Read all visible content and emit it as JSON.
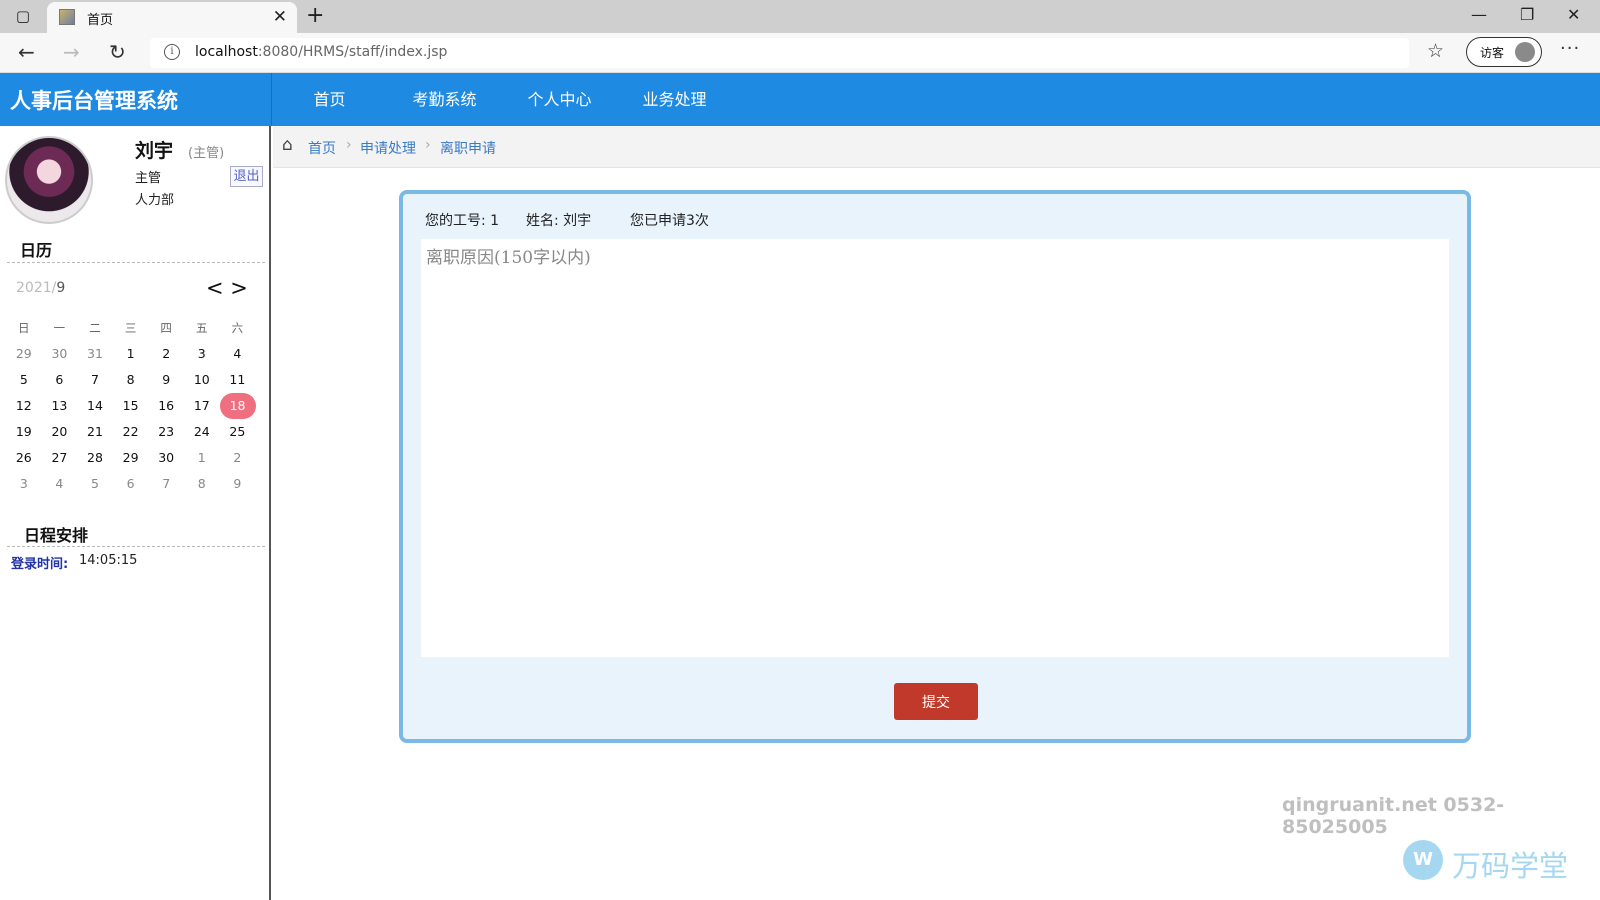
{
  "browser": {
    "tab_title": "首页",
    "url_host": "localhost",
    "url_path": ":8080/HRMS/staff/index.jsp",
    "profile_label": "访客"
  },
  "header": {
    "app_title": "人事后台管理系统",
    "nav": [
      "首页",
      "考勤系统",
      "个人中心",
      "业务处理"
    ],
    "bg_color": "#1f8ae1"
  },
  "user": {
    "name": "刘宇",
    "role_tag": "(主管)",
    "role": "主管",
    "department": "人力部",
    "logout_label": "退出"
  },
  "calendar": {
    "section_title": "日历",
    "year": "2021/",
    "month": "9",
    "prev": "<",
    "next": ">",
    "weekdays": [
      "日",
      "一",
      "二",
      "三",
      "四",
      "五",
      "六"
    ],
    "weeks": [
      [
        [
          "29",
          1
        ],
        [
          "30",
          1
        ],
        [
          "31",
          1
        ],
        [
          "1",
          0
        ],
        [
          "2",
          0
        ],
        [
          "3",
          0
        ],
        [
          "4",
          0
        ]
      ],
      [
        [
          "5",
          0
        ],
        [
          "6",
          0
        ],
        [
          "7",
          0
        ],
        [
          "8",
          0
        ],
        [
          "9",
          0
        ],
        [
          "10",
          0
        ],
        [
          "11",
          0
        ]
      ],
      [
        [
          "12",
          0
        ],
        [
          "13",
          0
        ],
        [
          "14",
          0
        ],
        [
          "15",
          0
        ],
        [
          "16",
          0
        ],
        [
          "17",
          0
        ],
        [
          "18",
          2
        ]
      ],
      [
        [
          "19",
          0
        ],
        [
          "20",
          0
        ],
        [
          "21",
          0
        ],
        [
          "22",
          0
        ],
        [
          "23",
          0
        ],
        [
          "24",
          0
        ],
        [
          "25",
          0
        ]
      ],
      [
        [
          "26",
          0
        ],
        [
          "27",
          0
        ],
        [
          "28",
          0
        ],
        [
          "29",
          0
        ],
        [
          "30",
          0
        ],
        [
          "1",
          1
        ],
        [
          "2",
          1
        ]
      ],
      [
        [
          "3",
          1
        ],
        [
          "4",
          1
        ],
        [
          "5",
          1
        ],
        [
          "6",
          1
        ],
        [
          "7",
          1
        ],
        [
          "8",
          1
        ],
        [
          "9",
          1
        ]
      ]
    ],
    "today_color": "#ef6e80"
  },
  "schedule": {
    "section_title": "日程安排",
    "login_label": "登录时间:",
    "login_time": "14:05:15"
  },
  "breadcrumb": [
    "首页",
    "申请处理",
    "离职申请"
  ],
  "form": {
    "employee_id": "您的工号: 1",
    "employee_name": "姓名: 刘宇",
    "apply_count": "您已申请3次",
    "reason_placeholder": "离职原因(150字以内)",
    "submit_label": "提交"
  },
  "watermark": {
    "contact": "qingruanit.net 0532-85025005",
    "brand": "万码学堂"
  }
}
